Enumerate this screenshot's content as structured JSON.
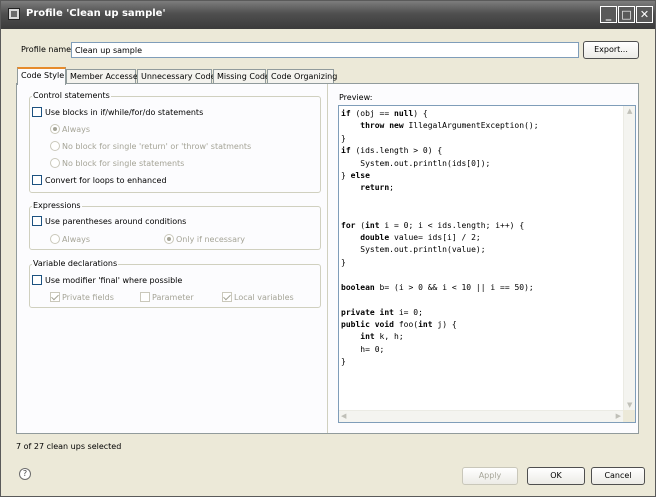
{
  "window": {
    "title": "Profile 'Clean up sample'",
    "controls": {
      "minimize": "_",
      "maximize": "□",
      "close": "✕"
    }
  },
  "profile": {
    "label": "Profile name:",
    "value": "Clean up sample",
    "export_button": "Export..."
  },
  "tabs": [
    {
      "label": "Code Style",
      "active": true
    },
    {
      "label": "Member Accesses",
      "active": false
    },
    {
      "label": "Unnecessary Code",
      "active": false
    },
    {
      "label": "Missing Code",
      "active": false
    },
    {
      "label": "Code Organizing",
      "active": false
    }
  ],
  "control_statements": {
    "title": "Control statements",
    "use_blocks": {
      "label": "Use blocks in if/while/for/do statements",
      "checked": false
    },
    "radio_always": {
      "label": "Always",
      "checked": true,
      "enabled": false
    },
    "radio_no_block_return": {
      "label": "No block for single 'return' or 'throw' statments",
      "checked": false,
      "enabled": false
    },
    "radio_no_block_single": {
      "label": "No block for single statements",
      "checked": false,
      "enabled": false
    },
    "convert_loops": {
      "label": "Convert for loops to enhanced",
      "checked": false
    }
  },
  "expressions": {
    "title": "Expressions",
    "use_parentheses": {
      "label": "Use parentheses around conditions",
      "checked": false
    },
    "radio_always": {
      "label": "Always",
      "checked": false,
      "enabled": false
    },
    "radio_only_if_necessary": {
      "label": "Only if necessary",
      "checked": true,
      "enabled": false
    }
  },
  "variable_declarations": {
    "title": "Variable declarations",
    "use_final": {
      "label": "Use modifier 'final' where possible",
      "checked": false
    },
    "private_fields": {
      "label": "Private fields",
      "checked": true,
      "enabled": false
    },
    "parameter": {
      "label": "Parameter",
      "checked": false,
      "enabled": false
    },
    "local_variables": {
      "label": "Local variables",
      "checked": true,
      "enabled": false
    }
  },
  "preview": {
    "label": "Preview:",
    "code_lines": [
      "if (obj == null) {",
      "    throw new IllegalArgumentException();",
      "}",
      "if (ids.length > 0) {",
      "    System.out.println(ids[0]);",
      "} else",
      "    return;",
      "",
      "",
      "for (int i = 0; i < ids.length; i++) {",
      "    double value= ids[i] / 2;",
      "    System.out.println(value);",
      "}",
      "",
      "boolean b= (i > 0 && i < 10 || i == 50);",
      "",
      "private int i= 0;",
      "public void foo(int j) {",
      "    int k, h;",
      "    h= 0;",
      "}"
    ],
    "keywords": [
      "if",
      "throw",
      "new",
      "else",
      "return",
      "for",
      "int",
      "double",
      "boolean",
      "private",
      "public",
      "void",
      "null"
    ]
  },
  "status_text": "7 of 27 clean ups selected",
  "buttons": {
    "apply": "Apply",
    "ok": "OK",
    "cancel": "Cancel"
  },
  "icons": {
    "help": "help-icon",
    "window": "window-icon"
  }
}
